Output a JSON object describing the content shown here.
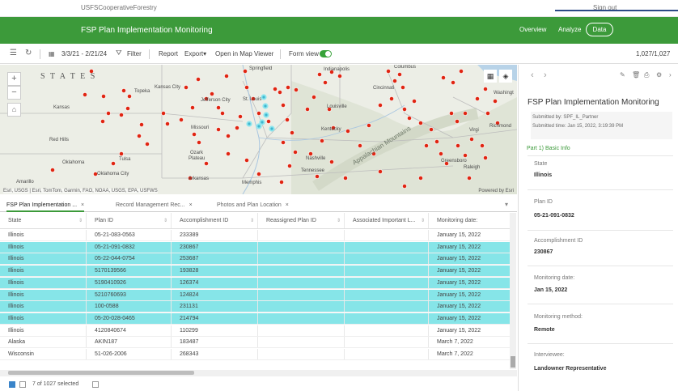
{
  "account": {
    "org": "USFSCooperativeForestry",
    "signout": "Sign out"
  },
  "header": {
    "title": "FSP Plan Implementation Monitoring",
    "nav": [
      "Overview",
      "Analyze",
      "Data"
    ],
    "brand_color": "#3c9a3a"
  },
  "toolbar": {
    "date_range": "3/3/21 - 2/21/24",
    "filter": "Filter",
    "report": "Report",
    "export": "Export",
    "open_map": "Open in Map Viewer",
    "form_view": "Form view",
    "count": "1,027/1,027"
  },
  "map": {
    "states_label": "S T A T E S",
    "labels": {
      "springfield": "Springfield",
      "indianapolis": "Indianapolis",
      "columbus": "Columbus",
      "topeka": "Topeka",
      "kansas_city": "Kansas City",
      "cincinnati": "Cincinnati",
      "washington": "Washingt",
      "kansas": "Kansas",
      "jefferson_city": "Jefferson City",
      "st_louis": "St. Louis",
      "louisville": "Louisville",
      "missouri": "Missouri",
      "richmond": "Richmond",
      "red_hills": "Red Hills",
      "kentucky": "Kentucky",
      "oklahoma": "Oklahoma",
      "tulsa": "Tulsa",
      "ozark": "Ozark",
      "plateau": "Plateau",
      "nashville": "Nashville",
      "tennessee": "Tennessee",
      "greensboro": "Greensboro",
      "raleigh": "Raleigh",
      "oklahoma_city": "Oklahoma City",
      "arkansas": "Arkansas",
      "memphis": "Memphis",
      "amarillo": "Amarillo",
      "appalachian": "Appalachian Mountains",
      "virginia": "Virgi"
    },
    "attribution": "Esri, USGS | Esri, TomTom, Garmin, FAO, NOAA, USGS, EPA, USFWS",
    "powered": "Powered by Esri"
  },
  "tabs": [
    {
      "label": "FSP Plan Implementation ...",
      "active": true
    },
    {
      "label": "Record Management Rec...",
      "active": false
    },
    {
      "label": "Photos and Plan Location",
      "active": false
    }
  ],
  "table": {
    "columns": [
      "State",
      "Plan ID",
      "Accomplishment ID",
      "Reassigned Plan ID",
      "Associated Important L...",
      "Monitoring date:"
    ],
    "rows": [
      {
        "state": "Illinois",
        "plan_id": "05-21-083-0563",
        "acc_id": "233389",
        "reassigned": "",
        "assoc": "",
        "date": "January 15, 2022",
        "selected": false
      },
      {
        "state": "Illinois",
        "plan_id": "05-21-091-0832",
        "acc_id": "230867",
        "reassigned": "",
        "assoc": "",
        "date": "January 15, 2022",
        "selected": true
      },
      {
        "state": "Illinois",
        "plan_id": "05-22-044-0754",
        "acc_id": "253687",
        "reassigned": "",
        "assoc": "",
        "date": "January 15, 2022",
        "selected": true
      },
      {
        "state": "Illinois",
        "plan_id": "5170139566",
        "acc_id": "193828",
        "reassigned": "",
        "assoc": "",
        "date": "January 15, 2022",
        "selected": true
      },
      {
        "state": "Illinois",
        "plan_id": "5190410926",
        "acc_id": "126374",
        "reassigned": "",
        "assoc": "",
        "date": "January 15, 2022",
        "selected": true
      },
      {
        "state": "Illinois",
        "plan_id": "5210760693",
        "acc_id": "124824",
        "reassigned": "",
        "assoc": "",
        "date": "January 15, 2022",
        "selected": true
      },
      {
        "state": "Illinois",
        "plan_id": "100-0588",
        "acc_id": "231131",
        "reassigned": "",
        "assoc": "",
        "date": "January 15, 2022",
        "selected": true
      },
      {
        "state": "Illinois",
        "plan_id": "05-20-028-0465",
        "acc_id": "214794",
        "reassigned": "",
        "assoc": "",
        "date": "January 15, 2022",
        "selected": true
      },
      {
        "state": "Illinois",
        "plan_id": "4120840674",
        "acc_id": "110299",
        "reassigned": "",
        "assoc": "",
        "date": "January 15, 2022",
        "selected": false
      },
      {
        "state": "Alaska",
        "plan_id": "AKIN187",
        "acc_id": "183487",
        "reassigned": "",
        "assoc": "",
        "date": "March 7, 2022",
        "selected": false
      },
      {
        "state": "Wisconsin",
        "plan_id": "51-026-2006",
        "acc_id": "268343",
        "reassigned": "",
        "assoc": "",
        "date": "March 7, 2022",
        "selected": false
      }
    ],
    "selection_color": "#86e5e8"
  },
  "footer": {
    "selected_text": "7 of 1027 selected"
  },
  "panel": {
    "title": "FSP Plan Implementation Monitoring",
    "submitted_by": "Submitted by:  SPF_IL_Partner",
    "submitted_time": "Submitted time:  Jan 15, 2022, 3:19:39 PM",
    "section": "Part 1) Basic Info",
    "fields": [
      {
        "label": "State",
        "value": "Illinois"
      },
      {
        "label": "Plan ID",
        "value": "05-21-091-0832"
      },
      {
        "label": "Accomplishment ID",
        "value": "230867"
      },
      {
        "label": "Monitoring date:",
        "value": "Jan 15, 2022"
      },
      {
        "label": "Monitoring method:",
        "value": "Remote"
      },
      {
        "label": "Interviewee:",
        "value": "Landowner Representative"
      }
    ]
  }
}
